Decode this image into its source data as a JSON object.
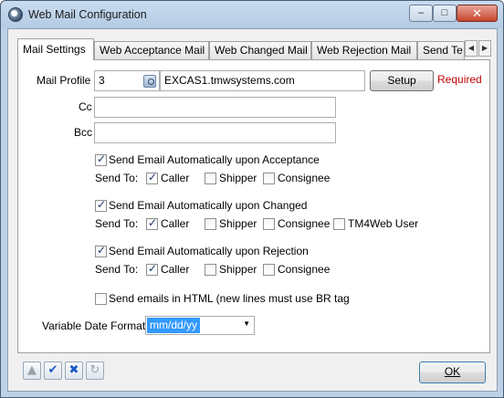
{
  "window": {
    "title": "Web Mail Configuration"
  },
  "titlebar_buttons": {
    "minimize": "–",
    "maximize": "□",
    "close": "✕"
  },
  "tabs": [
    {
      "label": "Mail Settings",
      "active": true
    },
    {
      "label": "Web Acceptance Mail",
      "active": false
    },
    {
      "label": "Web Changed Mail",
      "active": false
    },
    {
      "label": "Web Rejection Mail",
      "active": false
    },
    {
      "label": "Send Te",
      "active": false
    }
  ],
  "tab_scroll": {
    "left": "◀",
    "right": "▶"
  },
  "mail_profile": {
    "label": "Mail Profile",
    "id_value": "3",
    "name_value": "EXCAS1.tmwsystems.com",
    "setup_label": "Setup",
    "required_text": "Required"
  },
  "cc": {
    "label": "Cc",
    "value": ""
  },
  "bcc": {
    "label": "Bcc",
    "value": ""
  },
  "acceptance": {
    "checkbox_label": "Send Email Automatically upon Acceptance",
    "checked": true,
    "send_to_label": "Send To:",
    "options": [
      {
        "label": "Caller",
        "checked": true
      },
      {
        "label": "Shipper",
        "checked": false
      },
      {
        "label": "Consignee",
        "checked": false
      }
    ]
  },
  "changed": {
    "checkbox_label": "Send Email Automatically upon Changed",
    "checked": true,
    "send_to_label": "Send To:",
    "options": [
      {
        "label": "Caller",
        "checked": true
      },
      {
        "label": "Shipper",
        "checked": false
      },
      {
        "label": "Consignee",
        "checked": false
      },
      {
        "label": "TM4Web User",
        "checked": false
      }
    ]
  },
  "rejection": {
    "checkbox_label": "Send Email Automatically upon Rejection",
    "checked": true,
    "send_to_label": "Send To:",
    "options": [
      {
        "label": "Caller",
        "checked": true
      },
      {
        "label": "Shipper",
        "checked": false
      },
      {
        "label": "Consignee",
        "checked": false
      }
    ]
  },
  "html_option": {
    "label": "Send emails in HTML (new lines must use BR tag",
    "checked": false
  },
  "date_format": {
    "label": "Variable Date Format",
    "value": "mm/dd/yy"
  },
  "toolbar": {
    "up_icon": "▲",
    "save_icon": "✔",
    "cancel_icon": "✖",
    "refresh_icon": "↻"
  },
  "ok_label": "OK"
}
